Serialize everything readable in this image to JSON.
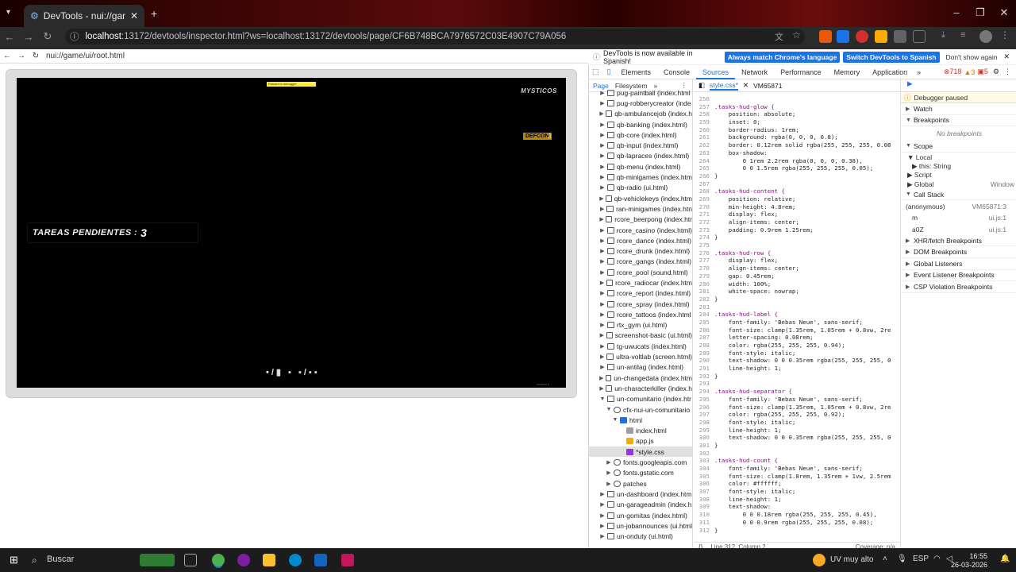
{
  "browser": {
    "tab_title": "DevTools - nui://game/ui/root.h",
    "url_host": "localhost",
    "url_rest": ":13172/devtools/inspector.html?ws=localhost:13172/devtools/page/CF6B748BCA7976572C03E4907C79A056"
  },
  "page": {
    "url": "nui://game/ui/root.html",
    "paused_label": "Paused in debugger",
    "logo": "MYSTICOS",
    "defcon_label": "DEFCON",
    "defcon_value": "3",
    "tasks_label": "TAREAS PENDIENTES :",
    "tasks_count": "3",
    "bottom_hud": "•/▮ ▪ ▪/▪▪",
    "corner_text": "version 0"
  },
  "devtools": {
    "info_text": "DevTools is now available in Spanish!",
    "info_btn1": "Always match Chrome's language",
    "info_btn2": "Switch DevTools to Spanish",
    "info_btn3": "Don't show again",
    "tabs": [
      "Elements",
      "Console",
      "Sources",
      "Network",
      "Performance",
      "Memory",
      "Application"
    ],
    "active_tab": "Sources",
    "errors": "718",
    "warnings": "3",
    "issues": "5",
    "nav_tabs": [
      "Page",
      "Filesystem"
    ],
    "tree": [
      {
        "label": "pug-paintball (index.html",
        "indent": 1,
        "type": "folder"
      },
      {
        "label": "pug-robberycreator (inde",
        "indent": 1,
        "type": "folder"
      },
      {
        "label": "qb-ambulancejob (index.h",
        "indent": 1,
        "type": "folder"
      },
      {
        "label": "qb-banking (index.html)",
        "indent": 1,
        "type": "folder"
      },
      {
        "label": "qb-core (index.html)",
        "indent": 1,
        "type": "folder"
      },
      {
        "label": "qb-input (index.html)",
        "indent": 1,
        "type": "folder"
      },
      {
        "label": "qb-lapraces (index.html)",
        "indent": 1,
        "type": "folder"
      },
      {
        "label": "qb-menu (index.html)",
        "indent": 1,
        "type": "folder"
      },
      {
        "label": "qb-minigames (index.htm",
        "indent": 1,
        "type": "folder"
      },
      {
        "label": "qb-radio (ui.html)",
        "indent": 1,
        "type": "folder"
      },
      {
        "label": "qb-vehiclekeys (index.htm",
        "indent": 1,
        "type": "folder"
      },
      {
        "label": "ran-minigames (index.htn",
        "indent": 1,
        "type": "folder"
      },
      {
        "label": "rcore_beerpong (index.htr",
        "indent": 1,
        "type": "folder"
      },
      {
        "label": "rcore_casino (index.html)",
        "indent": 1,
        "type": "folder"
      },
      {
        "label": "rcore_dance (index.html)",
        "indent": 1,
        "type": "folder"
      },
      {
        "label": "rcore_drunk (index.html)",
        "indent": 1,
        "type": "folder"
      },
      {
        "label": "rcore_gangs (index.html)",
        "indent": 1,
        "type": "folder"
      },
      {
        "label": "rcore_pool (sound.html)",
        "indent": 1,
        "type": "folder"
      },
      {
        "label": "rcore_radiocar (index.htm",
        "indent": 1,
        "type": "folder"
      },
      {
        "label": "rcore_report (index.html)",
        "indent": 1,
        "type": "folder"
      },
      {
        "label": "rcore_spray (index.html)",
        "indent": 1,
        "type": "folder"
      },
      {
        "label": "rcore_tattoos (index.html",
        "indent": 1,
        "type": "folder"
      },
      {
        "label": "rtx_gym (ui.html)",
        "indent": 1,
        "type": "folder"
      },
      {
        "label": "screenshot-basic (ui.html)",
        "indent": 1,
        "type": "folder"
      },
      {
        "label": "tg-uwucats (index.html)",
        "indent": 1,
        "type": "folder"
      },
      {
        "label": "ultra-voltlab (screen.html)",
        "indent": 1,
        "type": "folder"
      },
      {
        "label": "un-antilag (index.html)",
        "indent": 1,
        "type": "folder"
      },
      {
        "label": "un-changedata (index.htm",
        "indent": 1,
        "type": "folder"
      },
      {
        "label": "un-characterkiller (index.h",
        "indent": 1,
        "type": "folder"
      },
      {
        "label": "un-comunitario (index.htr",
        "indent": 1,
        "type": "folder-open"
      },
      {
        "label": "cfx-nui-un-comunitario",
        "indent": 2,
        "type": "cloud-open"
      },
      {
        "label": "html",
        "indent": 3,
        "type": "dir-open"
      },
      {
        "label": "index.html",
        "indent": 4,
        "type": "file"
      },
      {
        "label": "app.js",
        "indent": 4,
        "type": "js"
      },
      {
        "label": "*style.css",
        "indent": 4,
        "type": "css",
        "selected": true
      },
      {
        "label": "fonts.googleapis.com",
        "indent": 2,
        "type": "cloud"
      },
      {
        "label": "fonts.gstatic.com",
        "indent": 2,
        "type": "cloud"
      },
      {
        "label": "patches",
        "indent": 2,
        "type": "cloud"
      },
      {
        "label": "un-dashboard (index.htm",
        "indent": 1,
        "type": "folder"
      },
      {
        "label": "un-garageadmin (index.h",
        "indent": 1,
        "type": "folder"
      },
      {
        "label": "un-gomitas (index.html)",
        "indent": 1,
        "type": "folder"
      },
      {
        "label": "un-jobannounces (ui.html",
        "indent": 1,
        "type": "folder"
      },
      {
        "label": "un-onduty (ui.html)",
        "indent": 1,
        "type": "folder"
      }
    ],
    "editor_tabs": [
      "style.css*",
      "VM65871"
    ],
    "code_lines": [
      {
        "n": "256",
        "t": ""
      },
      {
        "n": "257",
        "t": ".tasks-hud-glow {"
      },
      {
        "n": "258",
        "t": "    position: absolute;"
      },
      {
        "n": "259",
        "t": "    inset: 0;"
      },
      {
        "n": "260",
        "t": "    border-radius: 1rem;"
      },
      {
        "n": "261",
        "t": "    background: rgba(0, 0, 0, 0.8);"
      },
      {
        "n": "262",
        "t": "    border: 0.12rem solid rgba(255, 255, 255, 0.08"
      },
      {
        "n": "263",
        "t": "    box-shadow:"
      },
      {
        "n": "264",
        "t": "        0 1rem 2.2rem rgba(0, 0, 0, 0.38),"
      },
      {
        "n": "265",
        "t": "        0 0 1.5rem rgba(255, 255, 255, 0.05);"
      },
      {
        "n": "266",
        "t": "}"
      },
      {
        "n": "267",
        "t": ""
      },
      {
        "n": "268",
        "t": ".tasks-hud-content {"
      },
      {
        "n": "269",
        "t": "    position: relative;"
      },
      {
        "n": "270",
        "t": "    min-height: 4.8rem;"
      },
      {
        "n": "271",
        "t": "    display: flex;"
      },
      {
        "n": "272",
        "t": "    align-items: center;"
      },
      {
        "n": "273",
        "t": "    padding: 0.9rem 1.25rem;"
      },
      {
        "n": "274",
        "t": "}"
      },
      {
        "n": "275",
        "t": ""
      },
      {
        "n": "276",
        "t": ".tasks-hud-row {"
      },
      {
        "n": "277",
        "t": "    display: flex;"
      },
      {
        "n": "278",
        "t": "    align-items: center;"
      },
      {
        "n": "279",
        "t": "    gap: 0.45rem;"
      },
      {
        "n": "280",
        "t": "    width: 100%;"
      },
      {
        "n": "281",
        "t": "    white-space: nowrap;"
      },
      {
        "n": "282",
        "t": "}"
      },
      {
        "n": "283",
        "t": ""
      },
      {
        "n": "284",
        "t": ".tasks-hud-label {"
      },
      {
        "n": "285",
        "t": "    font-family: 'Bebas Neue', sans-serif;"
      },
      {
        "n": "286",
        "t": "    font-size: clamp(1.35rem, 1.05rem + 0.8vw, 2re"
      },
      {
        "n": "287",
        "t": "    letter-spacing: 0.08rem;"
      },
      {
        "n": "288",
        "t": "    color: rgba(255, 255, 255, 0.94);"
      },
      {
        "n": "289",
        "t": "    font-style: italic;"
      },
      {
        "n": "290",
        "t": "    text-shadow: 0 0 0.35rem rgba(255, 255, 255, 0"
      },
      {
        "n": "291",
        "t": "    line-height: 1;"
      },
      {
        "n": "292",
        "t": "}"
      },
      {
        "n": "293",
        "t": ""
      },
      {
        "n": "294",
        "t": ".tasks-hud-separator {"
      },
      {
        "n": "295",
        "t": "    font-family: 'Bebas Neue', sans-serif;"
      },
      {
        "n": "296",
        "t": "    font-size: clamp(1.35rem, 1.05rem + 0.8vw, 2re"
      },
      {
        "n": "297",
        "t": "    color: rgba(255, 255, 255, 0.92);"
      },
      {
        "n": "298",
        "t": "    font-style: italic;"
      },
      {
        "n": "299",
        "t": "    line-height: 1;"
      },
      {
        "n": "300",
        "t": "    text-shadow: 0 0 0.35rem rgba(255, 255, 255, 0"
      },
      {
        "n": "301",
        "t": "}"
      },
      {
        "n": "302",
        "t": ""
      },
      {
        "n": "303",
        "t": ".tasks-hud-count {"
      },
      {
        "n": "304",
        "t": "    font-family: 'Bebas Neue', sans-serif;"
      },
      {
        "n": "305",
        "t": "    font-size: clamp(1.8rem, 1.35rem + 1vw, 2.5rem"
      },
      {
        "n": "306",
        "t": "    color: #ffffff;"
      },
      {
        "n": "307",
        "t": "    font-style: italic;"
      },
      {
        "n": "308",
        "t": "    line-height: 1;"
      },
      {
        "n": "309",
        "t": "    text-shadow:"
      },
      {
        "n": "310",
        "t": "        0 0 0.18rem rgba(255, 255, 255, 0.45),"
      },
      {
        "n": "311",
        "t": "        0 0 0.9rem rgba(255, 255, 255, 0.08);"
      },
      {
        "n": "312",
        "t": "}"
      }
    ],
    "status_pos": "Line 312, Column 2",
    "coverage": "Coverage: n/a",
    "debugger": {
      "paused": "Debugger paused",
      "watch": "Watch",
      "breakpoints": "Breakpoints",
      "no_breakpoints": "No breakpoints",
      "scope": "Scope",
      "local": "Local",
      "this_item": "this: String",
      "script": "Script",
      "global": "Global",
      "global_val": "Window",
      "call_stack": "Call Stack",
      "frames": [
        {
          "name": "(anonymous)",
          "loc": "VM65871:3"
        },
        {
          "name": "m",
          "loc": "ui.js:1"
        },
        {
          "name": "a0Z",
          "loc": "ui.js:1"
        }
      ],
      "sections": [
        "XHR/fetch Breakpoints",
        "DOM Breakpoints",
        "Global Listeners",
        "Event Listener Breakpoints",
        "CSP Violation Breakpoints"
      ]
    }
  },
  "taskbar": {
    "search": "Buscar",
    "weather": "UV muy alto",
    "lang": "ESP",
    "time": "16:55",
    "date": "26-03-2026"
  }
}
